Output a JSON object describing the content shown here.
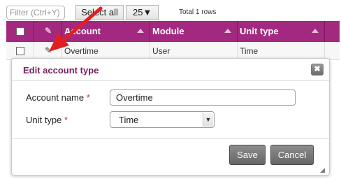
{
  "toolbar": {
    "filter_placeholder": "Filter (Ctrl+Y)",
    "select_all_label": "Select all",
    "page_size": "25",
    "page_size_arrow": "▼",
    "total_text": "Total 1 rows"
  },
  "grid": {
    "header_color": "#a3287f",
    "columns": [
      "Account",
      "Module",
      "Unit type"
    ],
    "edit_icon": "pencil-icon",
    "rows": [
      {
        "account": "Overtime",
        "module": "User",
        "unit_type": "Time"
      }
    ]
  },
  "dialog": {
    "title": "Edit account type",
    "close_icon": "close-icon",
    "close_glyph": "✖",
    "fields": {
      "account_name": {
        "label": "Account name",
        "required_mark": "*",
        "value": "Overtime"
      },
      "unit_type": {
        "label": "Unit type",
        "required_mark": "*",
        "value": "Time",
        "dropdown_glyph": "▼"
      }
    },
    "save_label": "Save",
    "cancel_label": "Cancel",
    "resize_icon": "resize-grip-icon",
    "resize_glyph": "◢"
  },
  "annotation": {
    "arrow_icon": "red-arrow-icon",
    "color": "#e02020"
  }
}
